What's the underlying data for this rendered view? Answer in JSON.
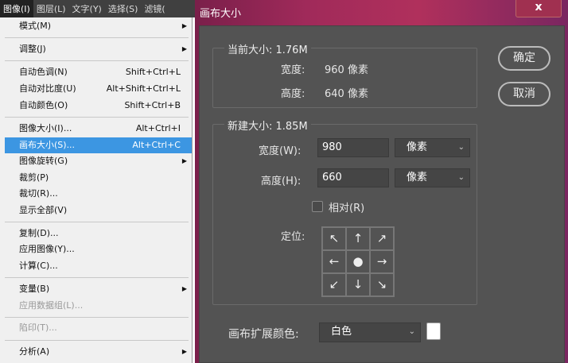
{
  "menubar": [
    "图像(I)",
    "图层(L)",
    "文字(Y)",
    "选择(S)",
    "滤镜("
  ],
  "menu": [
    {
      "label": "模式(M)",
      "submenu": true
    },
    {
      "label": "调整(J)",
      "submenu": true
    },
    {
      "label": "自动色调(N)",
      "shortcut": "Shift+Ctrl+L"
    },
    {
      "label": "自动对比度(U)",
      "shortcut": "Alt+Shift+Ctrl+L"
    },
    {
      "label": "自动颜色(O)",
      "shortcut": "Shift+Ctrl+B"
    },
    {
      "label": "图像大小(I)...",
      "shortcut": "Alt+Ctrl+I"
    },
    {
      "label": "画布大小(S)...",
      "shortcut": "Alt+Ctrl+C",
      "highlighted": true
    },
    {
      "label": "图像旋转(G)",
      "submenu": true
    },
    {
      "label": "裁剪(P)"
    },
    {
      "label": "裁切(R)..."
    },
    {
      "label": "显示全部(V)"
    },
    {
      "label": "复制(D)..."
    },
    {
      "label": "应用图像(Y)..."
    },
    {
      "label": "计算(C)..."
    },
    {
      "label": "变量(B)",
      "submenu": true
    },
    {
      "label": "应用数据组(L)...",
      "disabled": true
    },
    {
      "label": "陷印(T)...",
      "disabled": true
    },
    {
      "label": "分析(A)",
      "submenu": true
    }
  ],
  "dialog": {
    "title": "画布大小",
    "close": "x",
    "current": {
      "title": "当前大小: 1.76M",
      "width_label": "宽度:",
      "width_value": "960 像素",
      "height_label": "高度:",
      "height_value": "640 像素"
    },
    "new": {
      "title": "新建大小: 1.85M",
      "width_label": "宽度(W):",
      "width_value": "980",
      "width_unit": "像素",
      "height_label": "高度(H):",
      "height_value": "660",
      "height_unit": "像素",
      "relative_label": "相对(R)",
      "relative_checked": false,
      "anchor_label": "定位:",
      "anchor": [
        "↖",
        "↑",
        "↗",
        "←",
        "●",
        "→",
        "↙",
        "↓",
        "↘"
      ]
    },
    "ok": "确定",
    "cancel": "取消",
    "ext_color_label": "画布扩展颜色:",
    "ext_color_value": "白色",
    "ext_color_swatch": "#ffffff"
  }
}
